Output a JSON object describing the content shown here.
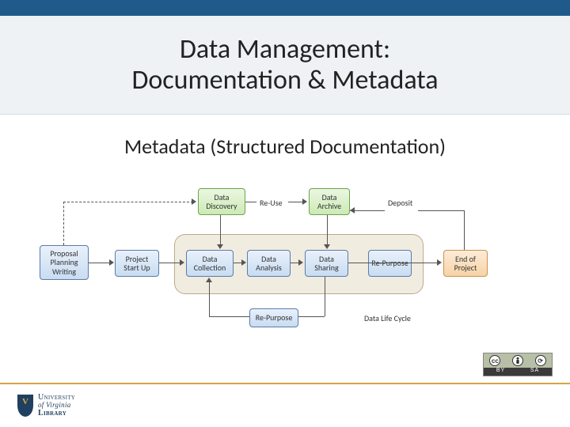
{
  "header": {
    "title_line1": "Data Management:",
    "title_line2": "Documentation & Metadata"
  },
  "subtitle": "Metadata (Structured Documentation)",
  "diagram": {
    "boxes": {
      "proposal": "Proposal\nPlanning\nWriting",
      "startup": "Project\nStart Up",
      "discovery": "Data\nDiscovery",
      "collection": "Data\nCollection",
      "analysis": "Data\nAnalysis",
      "sharing": "Data\nSharing",
      "archive": "Data\nArchive",
      "end": "End of\nProject"
    },
    "labels": {
      "reuse": "Re-Use",
      "repurpose": "Re-Purpose",
      "deposit": "Deposit",
      "cycle": "Data Life Cycle"
    }
  },
  "cc": {
    "by": "BY",
    "sa": "SA",
    "cc": "cc",
    "person": "⯑",
    "recycle": "⟳"
  },
  "logo": {
    "l1": "University",
    "l2": "of Virginia",
    "l3": "Library"
  }
}
